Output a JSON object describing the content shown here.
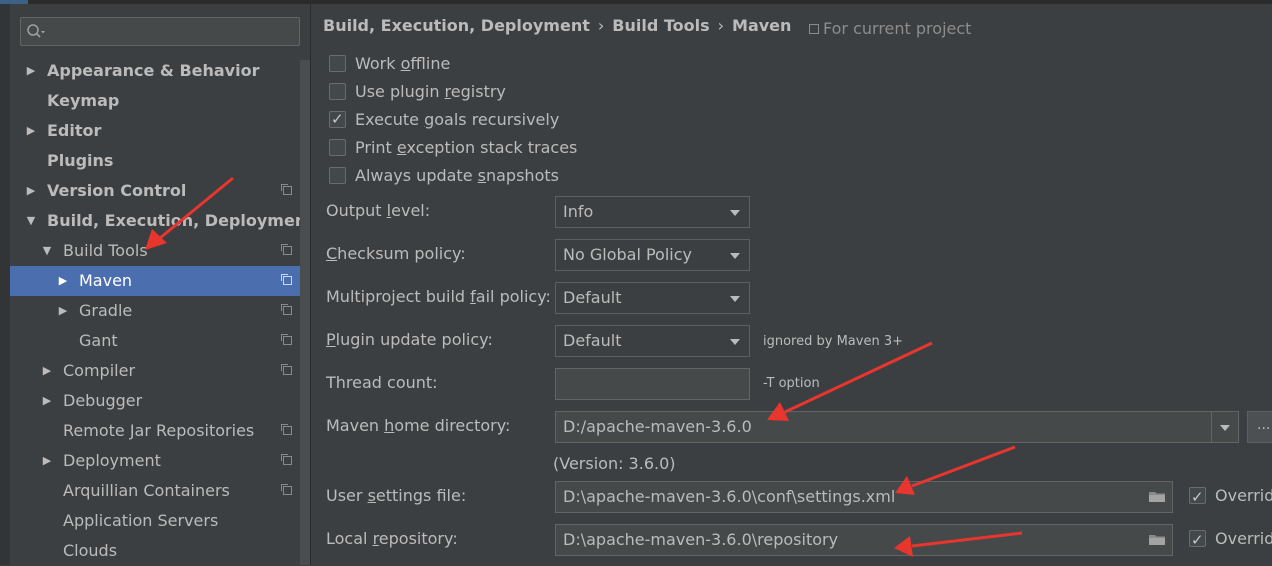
{
  "search": {
    "placeholder": ""
  },
  "sidebar": {
    "items": [
      {
        "label": "Appearance & Behavior",
        "expander": "collapsed",
        "level": 0,
        "bold": true
      },
      {
        "label": "Keymap",
        "expander": "none",
        "level": 0,
        "bold": true
      },
      {
        "label": "Editor",
        "expander": "collapsed",
        "level": 0,
        "bold": true
      },
      {
        "label": "Plugins",
        "expander": "none",
        "level": 0,
        "bold": true
      },
      {
        "label": "Version Control",
        "expander": "collapsed",
        "level": 0,
        "bold": true,
        "project_icon": true
      },
      {
        "label": "Build, Execution, Deployment",
        "expander": "expanded",
        "level": 0,
        "bold": true
      },
      {
        "label": "Build Tools",
        "expander": "expanded",
        "level": 1,
        "project_icon": true
      },
      {
        "label": "Maven",
        "expander": "collapsed",
        "level": 2,
        "selected": true,
        "project_icon": true
      },
      {
        "label": "Gradle",
        "expander": "collapsed",
        "level": 2,
        "project_icon": true
      },
      {
        "label": "Gant",
        "expander": "none",
        "level": 2,
        "project_icon": true
      },
      {
        "label": "Compiler",
        "expander": "collapsed",
        "level": 1,
        "project_icon": true
      },
      {
        "label": "Debugger",
        "expander": "collapsed",
        "level": 1
      },
      {
        "label": "Remote Jar Repositories",
        "expander": "none",
        "level": 1,
        "project_icon": true
      },
      {
        "label": "Deployment",
        "expander": "collapsed",
        "level": 1,
        "project_icon": true
      },
      {
        "label": "Arquillian Containers",
        "expander": "none",
        "level": 1,
        "project_icon": true
      },
      {
        "label": "Application Servers",
        "expander": "none",
        "level": 1
      },
      {
        "label": "Clouds",
        "expander": "none",
        "level": 1
      }
    ]
  },
  "breadcrumb": {
    "parts": [
      "Build, Execution, Deployment",
      "Build Tools",
      "Maven"
    ],
    "separator": "›",
    "scope": "For current project"
  },
  "checkboxes": [
    {
      "pre": "Work ",
      "mn": "o",
      "post": "ffline",
      "checked": false
    },
    {
      "pre": "Use plugin ",
      "mn": "r",
      "post": "egistry",
      "checked": false
    },
    {
      "pre": "Execute ",
      "mn": "g",
      "post": "oals recursively",
      "checked": true
    },
    {
      "pre": "Print ",
      "mn": "e",
      "post": "xception stack traces",
      "checked": false
    },
    {
      "pre": "Always update ",
      "mn": "s",
      "post": "napshots",
      "checked": false
    }
  ],
  "fields": {
    "output_level": {
      "pre": "Output ",
      "mn": "l",
      "post": "evel:",
      "value": "Info"
    },
    "checksum_policy": {
      "pre": "",
      "mn": "C",
      "post": "hecksum policy:",
      "value": "No Global Policy"
    },
    "multiproject_fail": {
      "pre": "Multiproject build ",
      "mn": "f",
      "post": "ail policy:",
      "value": "Default"
    },
    "plugin_update": {
      "pre": "",
      "mn": "P",
      "post": "lugin update policy:",
      "value": "Default",
      "note": "ignored by Maven 3+"
    },
    "thread_count": {
      "label": "Thread count:",
      "value": "",
      "note": "-T option"
    },
    "maven_home": {
      "pre": "Maven ",
      "mn": "h",
      "post": "ome directory:",
      "value": "D:/apache-maven-3.6.0",
      "browse": "...",
      "version": "(Version: 3.6.0)"
    },
    "user_settings": {
      "pre": "User ",
      "mn": "s",
      "post": "ettings file:",
      "value": "D:\\apache-maven-3.6.0\\conf\\settings.xml",
      "override": "Override",
      "override_checked": true
    },
    "local_repo": {
      "pre": "Local ",
      "mn": "r",
      "post": "epository:",
      "value": "D:\\apache-maven-3.6.0\\repository",
      "override": "Override",
      "override_checked": true
    }
  },
  "colors": {
    "background": "#3c3f41",
    "selection": "#4b6eaf",
    "text": "#bbbbbb",
    "annotation_arrow": "#e8352e"
  }
}
